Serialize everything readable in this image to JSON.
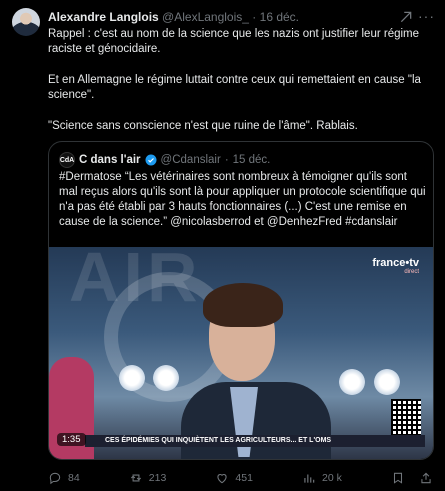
{
  "tweet": {
    "author_name": "Alexandre Langlois",
    "author_handle": "@AlexLanglois_",
    "separator": "·",
    "date": "16 déc.",
    "text_p1": "Rappel : c'est au nom de la science que les nazis ont justifier leur régime raciste et génocidaire.",
    "text_p2": "Et en Allemagne le régime luttait contre ceux qui remettaient en cause \"la science\".",
    "text_p3": "\"Science sans conscience n'est que ruine de l'âme\". Rablais.",
    "more_label": "···"
  },
  "quote": {
    "logo_text": "CdA",
    "author_name": "C dans l'air",
    "author_handle": "@Cdanslair",
    "separator": "·",
    "date": "15 déc.",
    "text": "#Dermatose “Les vétérinaires sont nombreux à témoigner qu'ils sont mal reçus alors qu'ils sont là pour appliquer un protocole scientifique qui n'a pas été établi par 3 hauts fonctionnaires (...) C'est une remise en cause de la science.” @nicolasberrod et @DenhezFred #cdanslair",
    "video": {
      "background_text": "AIR",
      "channel": "france•tv",
      "channel_sub": "direct",
      "ticker": "CES ÉPIDÉMIES QUI INQUIÈTENT LES AGRICULTEURS... ET L'OMS",
      "duration": "1:35"
    }
  },
  "actions": {
    "replies": "84",
    "reposts": "213",
    "likes": "451",
    "views": "20 k"
  },
  "icons": [
    "grok-icon",
    "more-icon",
    "verified-icon",
    "reply-icon",
    "repost-icon",
    "like-icon",
    "views-icon",
    "bookmark-icon",
    "share-icon"
  ],
  "colors": {
    "background": "#000000",
    "text": "#e7e9ea",
    "muted": "#71767b",
    "verified": "#1d9bf0",
    "border": "#2f3336"
  }
}
